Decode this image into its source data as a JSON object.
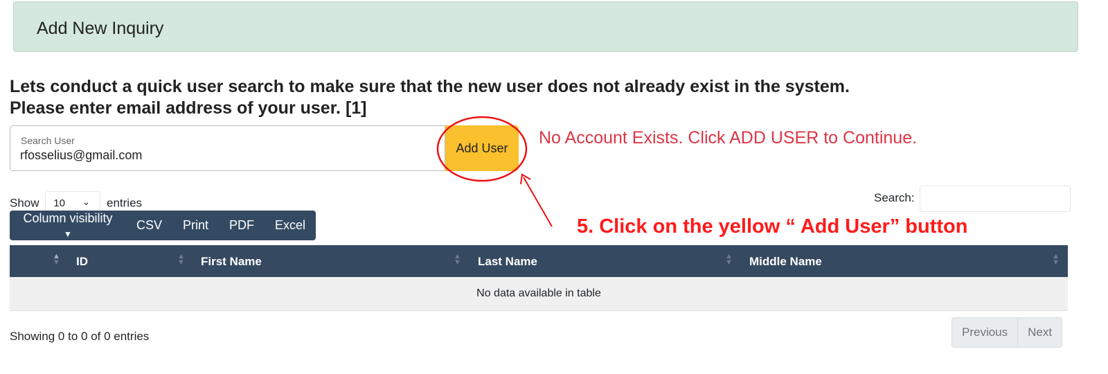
{
  "header": {
    "title": "Add New Inquiry"
  },
  "intro": {
    "line1": "Lets conduct a quick user search to make sure that the new user does not already exist in the system.",
    "line2": "Please enter email address of your user. [1]"
  },
  "search_user": {
    "label": "Search User",
    "value": "rfosselius@gmail.com"
  },
  "add_user_button": "Add User",
  "status_message": "No Account Exists. Click ADD USER to Continue.",
  "length": {
    "show": "Show",
    "value": "10",
    "entries": "entries"
  },
  "table_search": {
    "label": "Search:",
    "value": ""
  },
  "toolbar": {
    "column_visibility": "Column visibility",
    "csv": "CSV",
    "print": "Print",
    "pdf": "PDF",
    "excel": "Excel"
  },
  "annotation": "5. Click on the yellow “ Add User” button",
  "table": {
    "columns": [
      "ID",
      "First Name",
      "Last Name",
      "Middle Name"
    ],
    "empty": "No data available in table"
  },
  "footer": {
    "info": "Showing 0 to 0 of 0 entries",
    "previous": "Previous",
    "next": "Next"
  },
  "colors": {
    "header_bg": "#d4e8dd",
    "add_button": "#fbc02d",
    "toolbar": "#344a63",
    "message": "#dc3545",
    "annotation": "#ff1a1a"
  }
}
